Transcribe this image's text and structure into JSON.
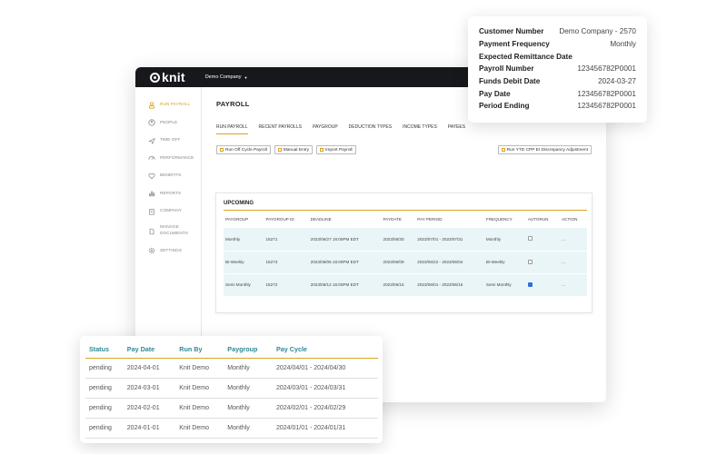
{
  "app": {
    "logo_text": "knit",
    "company_select": "Demo Company"
  },
  "sidebar": {
    "items": [
      {
        "label": "RUN PAYROLL",
        "icon": "payroll-icon",
        "active": true
      },
      {
        "label": "PEOPLE",
        "icon": "people-icon"
      },
      {
        "label": "TIME OFF",
        "icon": "plane-icon"
      },
      {
        "label": "PERFORMANCE",
        "icon": "gauge-icon"
      },
      {
        "label": "BENEFITS",
        "icon": "heart-icon"
      },
      {
        "label": "REPORTS",
        "icon": "bar-chart-icon"
      },
      {
        "label": "COMPANY",
        "icon": "company-icon"
      },
      {
        "label": "MANAGE",
        "label2": "DOCUMENTS",
        "icon": "documents-icon"
      },
      {
        "label": "SETTINGS",
        "icon": "gear-icon"
      }
    ]
  },
  "main": {
    "title": "PAYROLL",
    "tabs": [
      "RUN PAYROLL",
      "RECENT PAYROLLS",
      "PAYGROUP",
      "DEDUCTION TYPES",
      "INCOME TYPES",
      "PAYEES"
    ],
    "actions": {
      "off_cycle": "Run Off Cycle Payroll",
      "manual": "Manual Entry",
      "import": "Import Payroll",
      "ytd": "Run YTD CPP EI Discrepancy Adjustment"
    }
  },
  "upcoming": {
    "title": "UPCOMING",
    "columns": [
      "PAYGROUP",
      "PAYGROUP ID",
      "DEADLINE",
      "PAYDATE",
      "PAY PERIOD",
      "FREQUENCY",
      "AUTORUN",
      "ACTION"
    ],
    "rows": [
      {
        "paygroup": "Monthly",
        "id": "15271",
        "deadline": "2023/06/27 16:00PM EDT",
        "paydate": "2023/06/30",
        "period": "2023/07/01 - 2023/07/31",
        "frequency": "Monthly",
        "autorun": false,
        "action": "..."
      },
      {
        "paygroup": "Bi-Weekly",
        "id": "15273",
        "deadline": "2023/06/06 16:00PM EDT",
        "paydate": "2023/06/09",
        "period": "2023/05/22 - 2023/06/04",
        "frequency": "Bi-Weekly",
        "autorun": false,
        "action": "..."
      },
      {
        "paygroup": "Semi Monthly",
        "id": "15272",
        "deadline": "2023/06/12 16:00PM EDT",
        "paydate": "2023/06/15",
        "period": "2023/06/01 - 2023/06/15",
        "frequency": "Semi Monthly",
        "autorun": true,
        "action": "..."
      }
    ]
  },
  "info_card": {
    "rows": [
      {
        "key": "Customer Number",
        "value": "Demo Company - 2570"
      },
      {
        "key": "Payment Frequency",
        "value": "Monthly"
      },
      {
        "key": "Expected Remittance Date",
        "value": ""
      },
      {
        "key": "Payroll Number",
        "value": "123456782P0001"
      },
      {
        "key": "Funds Debit Date",
        "value": "2024-03-27"
      },
      {
        "key": "Pay Date",
        "value": "123456782P0001"
      },
      {
        "key": "Period Ending",
        "value": "123456782P0001"
      }
    ]
  },
  "history": {
    "columns": [
      "Status",
      "Pay Date",
      "Run By",
      "Paygroup",
      "Pay Cycle"
    ],
    "rows": [
      [
        "pending",
        "2024-04-01",
        "Knit Demo",
        "Monthly",
        "2024/04/01 - 2024/04/30"
      ],
      [
        "pending",
        "2024-03-01",
        "Knit Demo",
        "Monthly",
        "2024/03/01 - 2024/03/31"
      ],
      [
        "pending",
        "2024-02-01",
        "Knit Demo",
        "Monthly",
        "2024/02/01 - 2024/02/29"
      ],
      [
        "pending",
        "2024-01-01",
        "Knit Demo",
        "Monthly",
        "2024/01/01 - 2024/01/31"
      ]
    ]
  },
  "colors": {
    "accent": "#d9a321",
    "teal_header": "#2d8a94",
    "topbar": "#16181b",
    "row_highlight": "#eaf5f8"
  }
}
